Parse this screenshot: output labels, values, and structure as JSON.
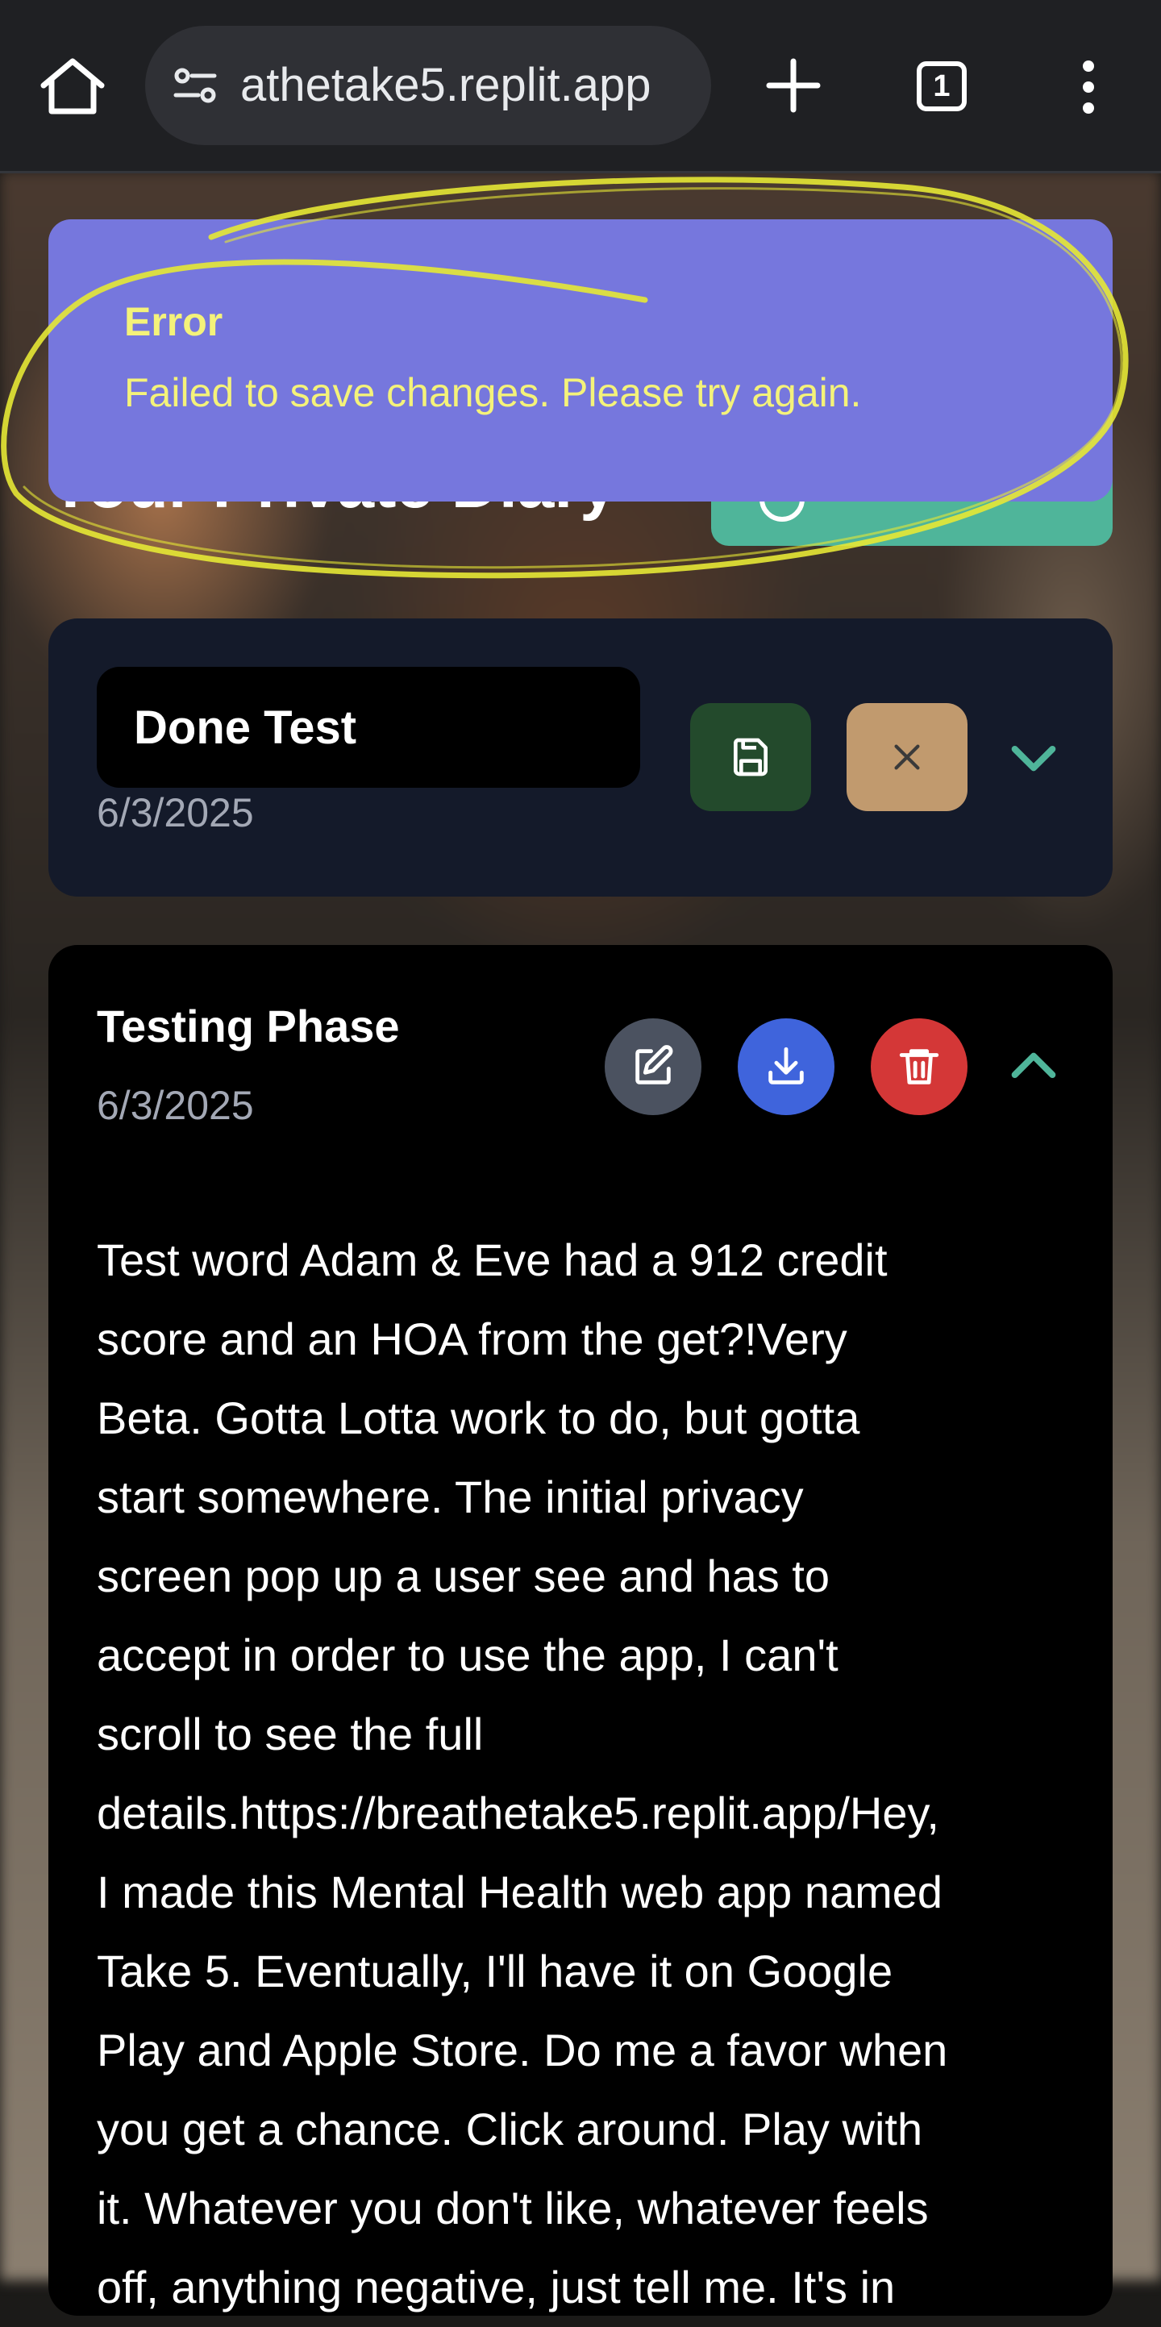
{
  "browser": {
    "url": "athetake5.replit.app",
    "tab_count": "1"
  },
  "page": {
    "title": "Your Private Diary"
  },
  "toast": {
    "title": "Error",
    "message": "Failed to save changes. Please try again."
  },
  "entries": [
    {
      "title": "Done Test",
      "date": "6/3/2025",
      "mode": "editing"
    },
    {
      "title": "Testing Phase",
      "date": "6/3/2025",
      "mode": "expanded",
      "body": "Test word Adam & Eve had a 912 credit\nscore and an HOA from the get?!Very\nBeta. Gotta Lotta work to do, but gotta\nstart somewhere. The initial privacy\nscreen pop up a user see and has to\naccept in order to use the app, I can't\nscroll to see the full\ndetails.https://breathetake5.replit.app/Hey,\nI made this Mental Health web app named\nTake 5. Eventually, I'll have it on Google\nPlay and Apple Store. Do me a favor when\nyou get a chance. Click around. Play with\nit. Whatever you don't like, whatever feels\noff, anything negative, just tell me. It's in"
    }
  ],
  "colors": {
    "toast_bg": "#7677dd",
    "toast_text": "#f4f27a",
    "accent_teal": "#4fb59a",
    "save_green": "#234a2c",
    "cancel_tan": "#c19a6e",
    "download_blue": "#3f64dc",
    "delete_red": "#d43737",
    "annotation_yellow": "#e6e835"
  },
  "icons": {
    "home": "home-icon",
    "site_settings": "site-settings-icon",
    "new_tab": "plus-icon",
    "menu": "more-vertical-icon",
    "save": "save-icon",
    "cancel": "close-icon",
    "edit": "edit-icon",
    "download": "download-icon",
    "delete": "trash-icon",
    "expand": "chevron-down-icon",
    "collapse": "chevron-up-icon"
  }
}
